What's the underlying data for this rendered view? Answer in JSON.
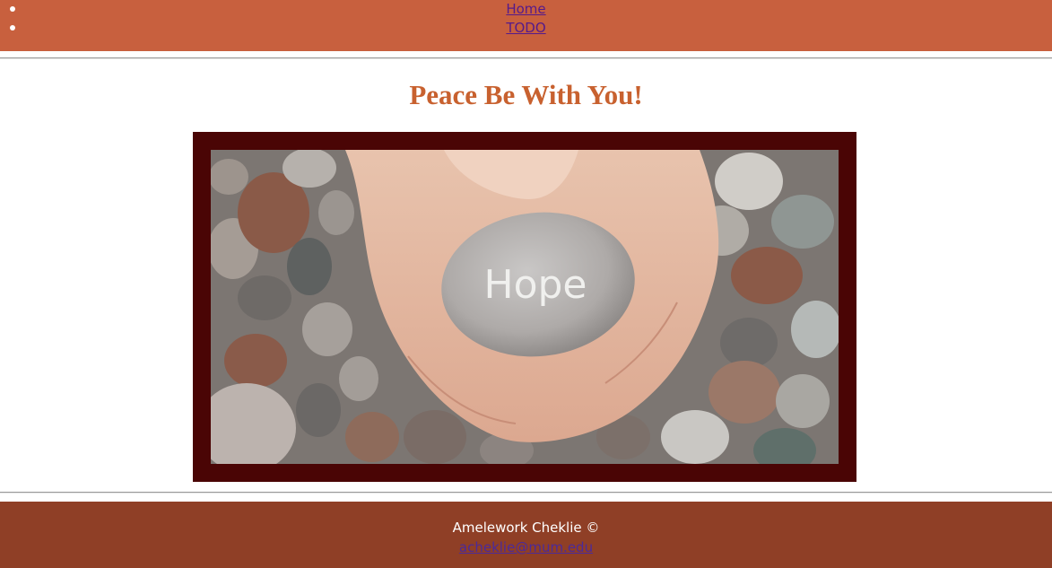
{
  "nav": {
    "items": [
      {
        "label": "Home"
      },
      {
        "label": "TODO"
      }
    ]
  },
  "main": {
    "title": "Peace Be With You!",
    "image": {
      "stone_text": "Hope"
    }
  },
  "footer": {
    "author": "Amelework Cheklie ©",
    "email": "acheklie@mum.edu"
  },
  "colors": {
    "nav_bg": "#c8603e",
    "title": "#c8612f",
    "frame": "#4a0505",
    "footer_bg": "#8f3f26",
    "link": "#551a8b"
  }
}
